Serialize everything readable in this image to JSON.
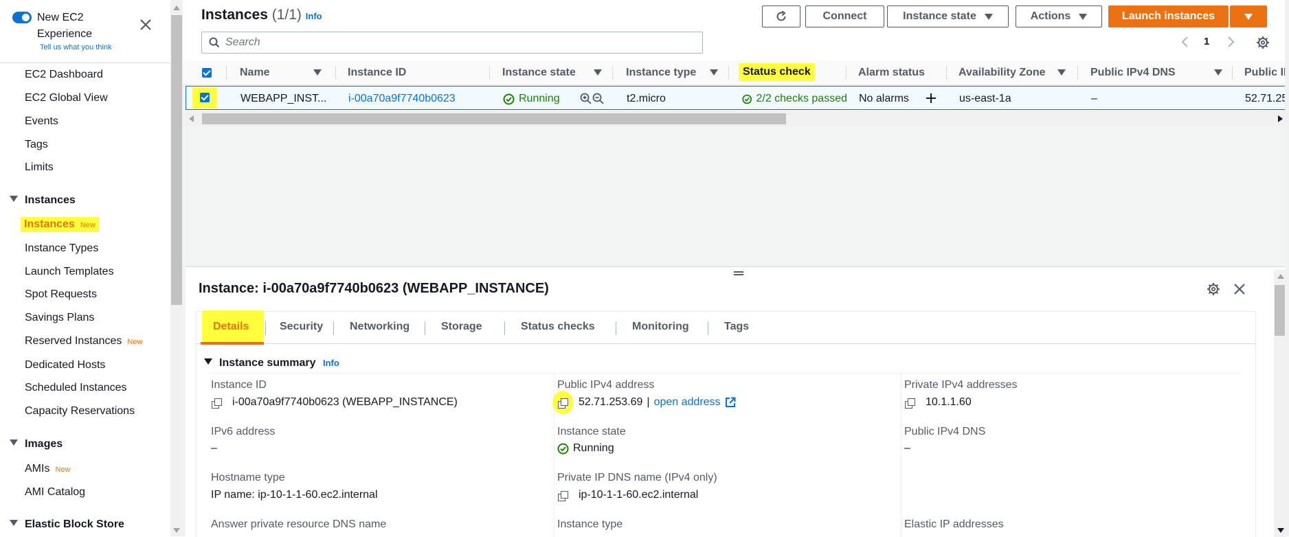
{
  "sidebar": {
    "title": "New EC2 Experience",
    "feedback": "Tell us what you think",
    "top_items": [
      {
        "label": "EC2 Dashboard"
      },
      {
        "label": "EC2 Global View"
      },
      {
        "label": "Events"
      },
      {
        "label": "Tags"
      },
      {
        "label": "Limits"
      }
    ],
    "instances_section": {
      "label": "Instances",
      "items": [
        {
          "label": "Instances",
          "badge": "New"
        },
        {
          "label": "Instance Types"
        },
        {
          "label": "Launch Templates"
        },
        {
          "label": "Spot Requests"
        },
        {
          "label": "Savings Plans"
        },
        {
          "label": "Reserved Instances",
          "badge": "New"
        },
        {
          "label": "Dedicated Hosts"
        },
        {
          "label": "Scheduled Instances"
        },
        {
          "label": "Capacity Reservations"
        }
      ]
    },
    "images_section": {
      "label": "Images",
      "items": [
        {
          "label": "AMIs",
          "badge": "New"
        },
        {
          "label": "AMI Catalog"
        }
      ]
    },
    "ebs_section": {
      "label": "Elastic Block Store"
    }
  },
  "header": {
    "title": "Instances",
    "count": "(1/1)",
    "info": "Info",
    "connect": "Connect",
    "instance_state": "Instance state",
    "actions": "Actions",
    "launch": "Launch instances",
    "search_placeholder": "Search",
    "page": "1"
  },
  "table": {
    "columns": {
      "name": "Name",
      "instance_id": "Instance ID",
      "instance_state": "Instance state",
      "instance_type": "Instance type",
      "status_check": "Status check",
      "alarm_status": "Alarm status",
      "az": "Availability Zone",
      "public_dns": "Public IPv4 DNS",
      "public_ip": "Public IPv4 ..."
    },
    "row": {
      "name": "WEBAPP_INST...",
      "instance_id": "i-00a70a9f7740b0623",
      "state": "Running",
      "type": "t2.micro",
      "status_check": "2/2 checks passed",
      "alarm": "No alarms",
      "az": "us-east-1a",
      "public_dns": "–",
      "public_ip": "52.71.25"
    }
  },
  "details": {
    "title": "Instance: i-00a70a9f7740b0623 (WEBAPP_INSTANCE)",
    "tabs": [
      {
        "label": "Details"
      },
      {
        "label": "Security"
      },
      {
        "label": "Networking"
      },
      {
        "label": "Storage"
      },
      {
        "label": "Status checks"
      },
      {
        "label": "Monitoring"
      },
      {
        "label": "Tags"
      }
    ],
    "summary_title": "Instance summary",
    "summary_info": "Info",
    "fields": {
      "instance_id_label": "Instance ID",
      "instance_id_value": "i-00a70a9f7740b0623 (WEBAPP_INSTANCE)",
      "public_ip_label": "Public IPv4 address",
      "public_ip_value": "52.71.253.69",
      "public_ip_sep": "|",
      "open_address": "open address",
      "private_ip_label": "Private IPv4 addresses",
      "private_ip_value": "10.1.1.60",
      "ipv6_label": "IPv6 address",
      "ipv6_value": "–",
      "state_label": "Instance state",
      "state_value": "Running",
      "public_dns_label": "Public IPv4 DNS",
      "public_dns_value": "–",
      "hostname_label": "Hostname type",
      "hostname_value": "IP name: ip-10-1-1-60.ec2.internal",
      "private_dns_label": "Private IP DNS name (IPv4 only)",
      "private_dns_value": "ip-10-1-1-60.ec2.internal",
      "answer_dns_label": "Answer private resource DNS name",
      "instance_type_label": "Instance type",
      "elastic_ip_label": "Elastic IP addresses"
    }
  },
  "colors": {
    "accent": "#ec7211",
    "link": "#0972d3",
    "success": "#1d8102",
    "highlight": "#ffff3c"
  }
}
